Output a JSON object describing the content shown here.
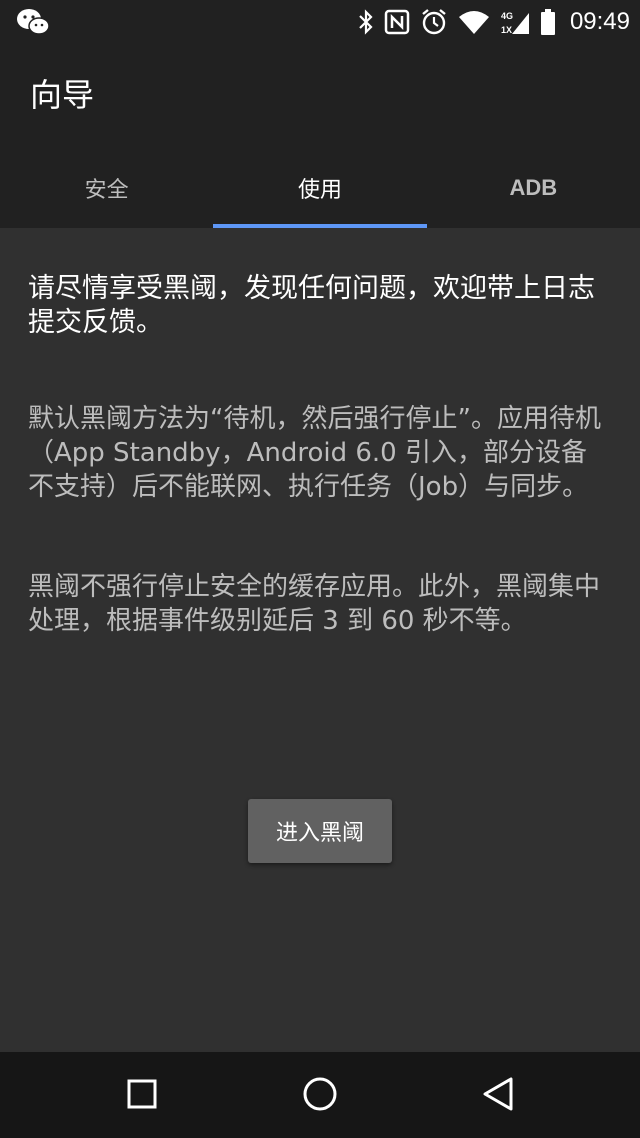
{
  "status_bar": {
    "time": "09:49",
    "network": "4G",
    "sim": "1X",
    "icons": [
      "wechat-icon",
      "bluetooth-icon",
      "nfc-icon",
      "alarm-icon",
      "wifi-icon",
      "signal-icon",
      "battery-icon"
    ]
  },
  "app_bar": {
    "title": "向导"
  },
  "tabs": [
    {
      "label": "安全",
      "active": false
    },
    {
      "label": "使用",
      "active": true
    },
    {
      "label": "ADB",
      "active": false
    }
  ],
  "main": {
    "intro": "请尽情享受黑阈，发现任何问题，欢迎带上日志提交反馈。",
    "paragraph1": "默认黑阈方法为“待机，然后强行停止”。应用待机（App Standby，Android 6.0 引入，部分设备不支持）后不能联网、执行任务（Job）与同步。",
    "paragraph2": "黑阈不强行停止安全的缓存应用。此外，黑阈集中处理，根据事件级别延后 3 到 60 秒不等。",
    "button_label": "进入黑阈"
  },
  "nav_bar": {
    "icons": [
      "recent-apps-icon",
      "home-icon",
      "back-icon"
    ]
  },
  "colors": {
    "accent": "#5e97f6",
    "app_bar_bg": "#212121",
    "content_bg": "#303030",
    "button_bg": "#616161",
    "secondary_text": "#bdbdbd"
  }
}
